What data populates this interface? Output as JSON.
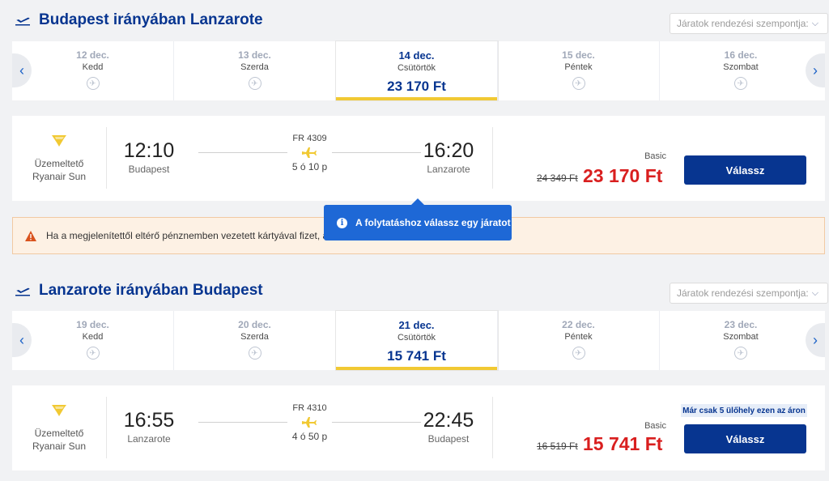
{
  "outbound": {
    "title": "Budapest irányában Lanzarote",
    "sort_label": "Járatok rendezési szempontja:",
    "dates": [
      {
        "date": "12 dec.",
        "weekday": "Kedd",
        "price": null
      },
      {
        "date": "13 dec.",
        "weekday": "Szerda",
        "price": null
      },
      {
        "date": "14 dec.",
        "weekday": "Csütörtök",
        "price": "23 170 Ft"
      },
      {
        "date": "15 dec.",
        "weekday": "Péntek",
        "price": null
      },
      {
        "date": "16 dec.",
        "weekday": "Szombat",
        "price": null
      }
    ],
    "flight": {
      "operator_label": "Üzemeltető",
      "operator_name": "Ryanair Sun",
      "depart_time": "12:10",
      "depart_city": "Budapest",
      "flight_number": "FR 4309",
      "duration": "5 ó 10 p",
      "arrive_time": "16:20",
      "arrive_city": "Lanzarote",
      "fare_class": "Basic",
      "old_price": "24 349 Ft",
      "price": "23 170 Ft",
      "button": "Válassz"
    }
  },
  "warning": {
    "text": "Ha a megjelenítettől eltérő pénznemben vezetett kártyával fizet, a"
  },
  "tooltip": {
    "text": "A folytatáshoz válassz egy járatot"
  },
  "return": {
    "title": "Lanzarote irányában Budapest",
    "sort_label": "Járatok rendezési szempontja:",
    "dates": [
      {
        "date": "19 dec.",
        "weekday": "Kedd",
        "price": null
      },
      {
        "date": "20 dec.",
        "weekday": "Szerda",
        "price": null
      },
      {
        "date": "21 dec.",
        "weekday": "Csütörtök",
        "price": "15 741 Ft"
      },
      {
        "date": "22 dec.",
        "weekday": "Péntek",
        "price": null
      },
      {
        "date": "23 dec.",
        "weekday": "Szombat",
        "price": null
      }
    ],
    "flight": {
      "operator_label": "Üzemeltető",
      "operator_name": "Ryanair Sun",
      "depart_time": "16:55",
      "depart_city": "Lanzarote",
      "flight_number": "FR 4310",
      "duration": "4 ó 50 p",
      "arrive_time": "22:45",
      "arrive_city": "Budapest",
      "fare_class": "Basic",
      "seats_badge": "Már csak 5 ülőhely ezen az áron",
      "old_price": "16 519 Ft",
      "price": "15 741 Ft",
      "button": "Válassz"
    }
  },
  "colors": {
    "brand_blue": "#073590",
    "accent_yellow": "#f1c933",
    "price_red": "#d91f1f",
    "tooltip_blue": "#1e68d6"
  }
}
